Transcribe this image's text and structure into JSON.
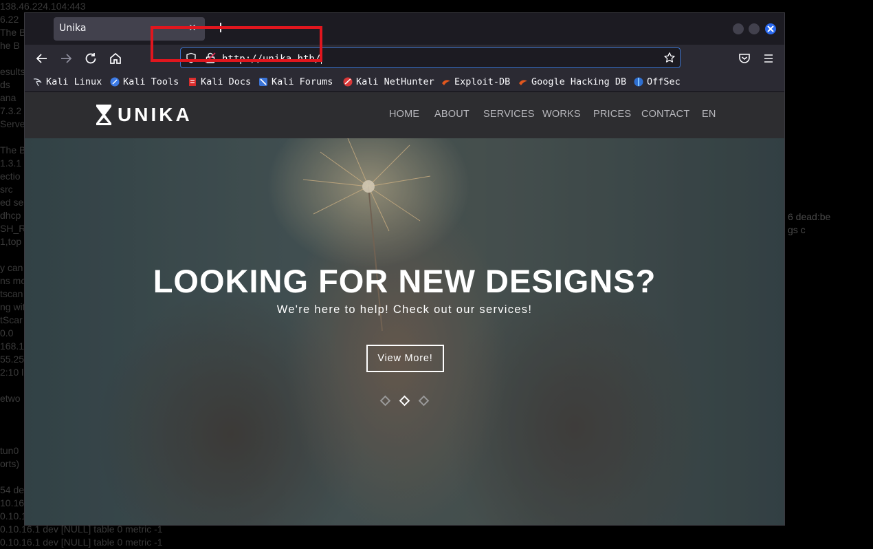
{
  "background_terminal": {
    "left_lines": [
      "138.46.224.104:443",
      "6.22",
      "The B",
      "he B",
      "",
      "esults",
      "ds",
      "ana",
      "7.3.2",
      "Serve",
      "",
      "The B",
      "1.3.1",
      "ectio",
      "src",
      "ed se",
      "dhcp",
      "SH_R",
      "1,top",
      "",
      "y can",
      "ns mo",
      "tscan",
      "ng wit",
      "tScar",
      "0.0",
      "168.1",
      "55.25",
      "2:10 l",
      "",
      "etwo",
      "",
      "",
      "",
      "tun0",
      "orts)",
      "",
      "54 dea",
      "10.16",
      "0.10.1",
      "0.10.16.1 dev [NULL] table 0 metric -1",
      "0.10.16.1 dev [NULL] table 0 metric -1"
    ],
    "right_lines": [
      "6 dead:be",
      "gs c"
    ]
  },
  "browser": {
    "tab_title": "Unika",
    "tab_close": "✕",
    "new_tab": "+",
    "url": "http://unika.htb/",
    "bookmarks": [
      {
        "label": "Kali Linux",
        "icon": "kali-dragon-icon"
      },
      {
        "label": "Kali Tools",
        "icon": "kali-tools-icon"
      },
      {
        "label": "Kali Docs",
        "icon": "kali-docs-icon"
      },
      {
        "label": "Kali Forums",
        "icon": "kali-forums-icon"
      },
      {
        "label": "Kali NetHunter",
        "icon": "nethunter-icon"
      },
      {
        "label": "Exploit-DB",
        "icon": "exploit-db-icon"
      },
      {
        "label": "Google Hacking DB",
        "icon": "ghdb-icon"
      },
      {
        "label": "OffSec",
        "icon": "offsec-icon"
      }
    ],
    "highlight_color": "#e0161e"
  },
  "site": {
    "logo_text": "UNIKA",
    "menu": [
      "HOME",
      "ABOUT",
      "SERVICES",
      "WORKS",
      "PRICES",
      "CONTACT",
      "EN"
    ],
    "hero": {
      "title": "LOOKING FOR NEW DESIGNS?",
      "subtitle": "We're here to help! Check out our services!",
      "button": "View More!",
      "slides": 3,
      "active_slide": 2
    }
  }
}
